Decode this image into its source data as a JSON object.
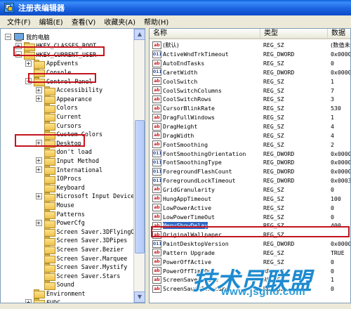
{
  "window": {
    "title": "注册表编辑器"
  },
  "menu": [
    "文件(F)",
    "编辑(E)",
    "查看(V)",
    "收藏夹(A)",
    "帮助(H)"
  ],
  "tree": [
    {
      "label": "我的电脑",
      "level": 0,
      "expander": "-",
      "icon": "computer"
    },
    {
      "label": "HKEY_CLASSES_ROOT",
      "level": 1,
      "expander": "+",
      "icon": "folder"
    },
    {
      "label": "HKEY_CURRENT_USER",
      "level": 1,
      "expander": "-",
      "icon": "folder"
    },
    {
      "label": "AppEvents",
      "level": 2,
      "expander": "+",
      "icon": "folder"
    },
    {
      "label": "Console",
      "level": 2,
      "expander": "",
      "icon": "folder"
    },
    {
      "label": "Control Panel",
      "level": 2,
      "expander": "-",
      "icon": "folder"
    },
    {
      "label": "Accessibility",
      "level": 3,
      "expander": "+",
      "icon": "folder"
    },
    {
      "label": "Appearance",
      "level": 3,
      "expander": "+",
      "icon": "folder"
    },
    {
      "label": "Colors",
      "level": 3,
      "expander": "",
      "icon": "folder"
    },
    {
      "label": "Current",
      "level": 3,
      "expander": "",
      "icon": "folder"
    },
    {
      "label": "Cursors",
      "level": 3,
      "expander": "",
      "icon": "folder"
    },
    {
      "label": "Custom Colors",
      "level": 3,
      "expander": "",
      "icon": "folder"
    },
    {
      "label": "Desktop",
      "level": 3,
      "expander": "+",
      "icon": "folder"
    },
    {
      "label": "don't load",
      "level": 3,
      "expander": "",
      "icon": "folder"
    },
    {
      "label": "Input Method",
      "level": 3,
      "expander": "+",
      "icon": "folder"
    },
    {
      "label": "International",
      "level": 3,
      "expander": "+",
      "icon": "folder"
    },
    {
      "label": "IOProcs",
      "level": 3,
      "expander": "",
      "icon": "folder"
    },
    {
      "label": "Keyboard",
      "level": 3,
      "expander": "",
      "icon": "folder"
    },
    {
      "label": "Microsoft Input Devices",
      "level": 3,
      "expander": "+",
      "icon": "folder"
    },
    {
      "label": "Mouse",
      "level": 3,
      "expander": "",
      "icon": "folder"
    },
    {
      "label": "Patterns",
      "level": 3,
      "expander": "",
      "icon": "folder"
    },
    {
      "label": "PowerCfg",
      "level": 3,
      "expander": "+",
      "icon": "folder"
    },
    {
      "label": "Screen Saver.3DFlyingOb",
      "level": 3,
      "expander": "",
      "icon": "folder"
    },
    {
      "label": "Screen Saver.3DPipes",
      "level": 3,
      "expander": "",
      "icon": "folder"
    },
    {
      "label": "Screen Saver.Bezier",
      "level": 3,
      "expander": "",
      "icon": "folder"
    },
    {
      "label": "Screen Saver.Marquee",
      "level": 3,
      "expander": "",
      "icon": "folder"
    },
    {
      "label": "Screen Saver.Mystify",
      "level": 3,
      "expander": "",
      "icon": "folder"
    },
    {
      "label": "Screen Saver.Stars",
      "level": 3,
      "expander": "",
      "icon": "folder"
    },
    {
      "label": "Sound",
      "level": 3,
      "expander": "",
      "icon": "folder"
    },
    {
      "label": "Environment",
      "level": 2,
      "expander": "",
      "icon": "folder"
    },
    {
      "label": "EUDC",
      "level": 2,
      "expander": "+",
      "icon": "folder"
    }
  ],
  "columns": {
    "name": "名称",
    "type": "类型",
    "data": "数据"
  },
  "values": [
    {
      "name": "(默认)",
      "type": "REG_SZ",
      "data": "(数值未",
      "kind": "sz"
    },
    {
      "name": "ActiveWndTrkTimeout",
      "type": "REG_DWORD",
      "data": "0x0000",
      "kind": "dw"
    },
    {
      "name": "AutoEndTasks",
      "type": "REG_SZ",
      "data": "0",
      "kind": "sz"
    },
    {
      "name": "CaretWidth",
      "type": "REG_DWORD",
      "data": "0x0000",
      "kind": "dw"
    },
    {
      "name": "CoolSwitch",
      "type": "REG_SZ",
      "data": "1",
      "kind": "sz"
    },
    {
      "name": "CoolSwitchColumns",
      "type": "REG_SZ",
      "data": "7",
      "kind": "sz"
    },
    {
      "name": "CoolSwitchRows",
      "type": "REG_SZ",
      "data": "3",
      "kind": "sz"
    },
    {
      "name": "CursorBlinkRate",
      "type": "REG_SZ",
      "data": "530",
      "kind": "sz"
    },
    {
      "name": "DragFullWindows",
      "type": "REG_SZ",
      "data": "1",
      "kind": "sz"
    },
    {
      "name": "DragHeight",
      "type": "REG_SZ",
      "data": "4",
      "kind": "sz"
    },
    {
      "name": "DragWidth",
      "type": "REG_SZ",
      "data": "4",
      "kind": "sz"
    },
    {
      "name": "FontSmoothing",
      "type": "REG_SZ",
      "data": "2",
      "kind": "sz"
    },
    {
      "name": "FontSmoothingOrientation",
      "type": "REG_DWORD",
      "data": "0x0000",
      "kind": "dw"
    },
    {
      "name": "FontSmoothingType",
      "type": "REG_DWORD",
      "data": "0x0000",
      "kind": "dw"
    },
    {
      "name": "ForegroundFlashCount",
      "type": "REG_DWORD",
      "data": "0x0000",
      "kind": "dw"
    },
    {
      "name": "ForegroundLockTimeout",
      "type": "REG_DWORD",
      "data": "0x0003",
      "kind": "dw"
    },
    {
      "name": "GridGranularity",
      "type": "REG_SZ",
      "data": "0",
      "kind": "sz"
    },
    {
      "name": "HungAppTimeout",
      "type": "REG_SZ",
      "data": "100",
      "kind": "sz"
    },
    {
      "name": "LowPowerActive",
      "type": "REG_SZ",
      "data": "0",
      "kind": "sz"
    },
    {
      "name": "LowPowerTimeOut",
      "type": "REG_SZ",
      "data": "0",
      "kind": "sz"
    },
    {
      "name": "MenuShowDelay",
      "type": "REG_SZ",
      "data": "400",
      "kind": "sz",
      "selected": true
    },
    {
      "name": "OriginalWallpaper",
      "type": "REG_SZ",
      "data": "",
      "kind": "sz"
    },
    {
      "name": "PaintDesktopVersion",
      "type": "REG_DWORD",
      "data": "0x0000",
      "kind": "dw"
    },
    {
      "name": "Pattern Upgrade",
      "type": "REG_SZ",
      "data": "TRUE",
      "kind": "sz"
    },
    {
      "name": "PowerOffActive",
      "type": "REG_SZ",
      "data": "0",
      "kind": "sz"
    },
    {
      "name": "PowerOffTimeOut",
      "type": "REG_SZ",
      "data": "0",
      "kind": "sz"
    },
    {
      "name": "ScreenSaveActive",
      "type": "REG_SZ",
      "data": "1",
      "kind": "sz"
    },
    {
      "name": "ScreenSaverIsSecure",
      "type": "REG_SZ",
      "data": "0",
      "kind": "sz"
    }
  ],
  "watermark": {
    "logo": "技术员联盟",
    "site": "www.jsgho.com"
  },
  "colors": {
    "highlight_box": "#C4141E",
    "selection": "#316AC5",
    "watermark_blue": "#1E8BD0"
  }
}
